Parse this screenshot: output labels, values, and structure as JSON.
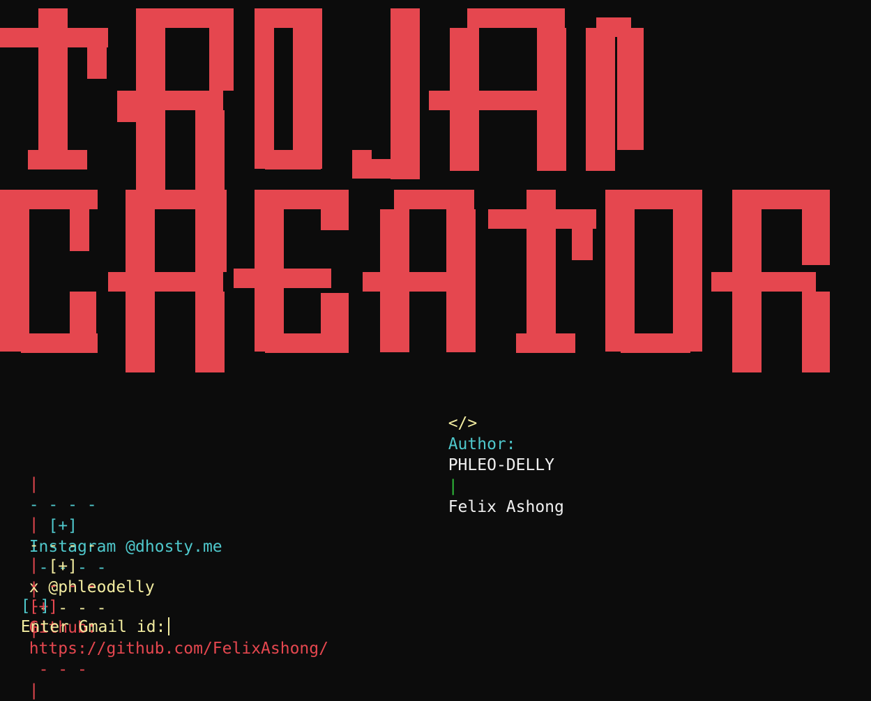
{
  "banner": {
    "text_line1": "TROJAN",
    "text_line2": "CREATOR",
    "color": "#e5474f"
  },
  "author": {
    "tag": "</>",
    "label": "Author:",
    "name": "PHLEO-DELLY",
    "separator": "|",
    "real_name": "Felix Ashong"
  },
  "links": [
    {
      "bar_left": "|",
      "dashes_left": "- - - -",
      "marker": "[+]",
      "text": "Instagram @dhosty.me",
      "dashes_right": "- - - -",
      "bar_right": "|"
    },
    {
      "bar_left": "|",
      "dashes_left": "- - - -",
      "marker": "[+]",
      "text": "x @phleodelly",
      "dashes_right": "- - - -",
      "bar_right": "|"
    },
    {
      "bar_left": "|",
      "dashes_left": "- - - -",
      "marker": "[+]",
      "label": "Github:",
      "text": "https://github.com/FelixAshong/",
      "dashes_right": "- - -",
      "bar_right": "|"
    }
  ],
  "prompt": {
    "marker_open": "[",
    "marker_sign": "-",
    "marker_close": "]",
    "text": "Enter Gmail id:"
  },
  "colors": {
    "background": "#0c0c0c",
    "accent_red": "#e5474f",
    "cyan": "#4fc8cc",
    "yellow": "#f2eca0",
    "green": "#2fbf3a",
    "white": "#f0f0f0"
  }
}
